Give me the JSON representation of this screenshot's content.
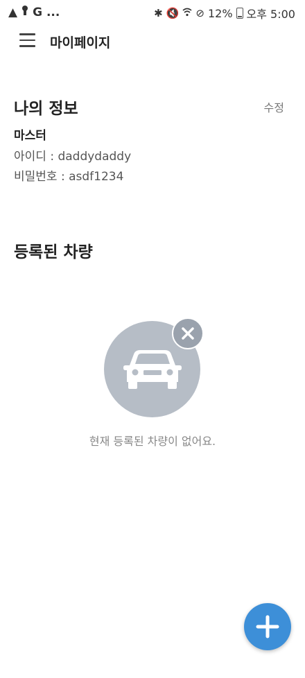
{
  "status_bar": {
    "left_icons": [
      "warning-icon",
      "keyhole-icon"
    ],
    "left_text": "G ...",
    "battery": "12%",
    "time": "오후 5:00"
  },
  "app_bar": {
    "title": "마이페이지",
    "menu_icon": "hamburger-menu-icon"
  },
  "my_info": {
    "title": "나의 정보",
    "edit_label": "수정",
    "name": "마스터",
    "id_label": "아이디 : daddydaddy",
    "password_label": "비밀번호 : asdf1234"
  },
  "vehicles": {
    "title": "등록된 차량",
    "empty_message": "현재 등록된 차량이 없어요.",
    "empty_icon": "car-icon",
    "badge_icon": "close-icon"
  },
  "fab": {
    "icon": "plus-icon",
    "color": "#3d8fd8"
  },
  "colors": {
    "circle": "#b6bdc6",
    "badge": "#9aa2ad",
    "fab": "#3d8fd8"
  }
}
